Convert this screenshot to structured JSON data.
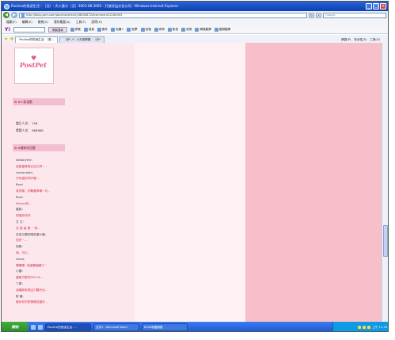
{
  "window": {
    "title": "Pauline的悦读生活 : 〔汉〕- 大人意义〔汉〕2003.08 2005 - 开放好出文化公司 - Windows Internet Explorer"
  },
  "address": {
    "url": "http://blog.yam.com/pauline/article/18630872#comment12164905",
    "search_placeholder": "Google"
  },
  "menu": [
    "檔案(F)",
    "編輯(E)",
    "檢視(V)",
    "我的最愛(A)",
    "工具(T)",
    "說明(H)"
  ],
  "yahoo_toolbar": {
    "logo": "Y!",
    "search_button": "網頁搜尋",
    "items": [
      "書籤",
      "首頁",
      "郵件",
      "知識+",
      "股票",
      "信箱",
      "奇摩",
      "影音",
      "相簿",
      "網頁翻譯",
      "闔閉翻譯"
    ]
  },
  "tabs": [
    {
      "label": "Pauline的悦读生活: 〔繁...",
      "active": true
    },
    {
      "label": "〔@*_*〕小天堂健康 - 〔@*",
      "active": false
    }
  ],
  "tab_tools": [
    "網頁(P)",
    "安全性(S)",
    "工具(O)"
  ],
  "blog": {
    "logo_text": "PostPet",
    "visits_header": "★人氣指數",
    "today_label": "當日人次：",
    "today_value": "158",
    "total_label": "累積人次：",
    "total_value": "888888",
    "comments_header": "★最新的回應",
    "comments": [
      {
        "who": "katablythe:",
        "msg": "這個還滿適合自己呀~..."
      },
      {
        "who": "rachanaldo:",
        "msg": "只有過的好好喔~..."
      },
      {
        "who": "Bowi",
        "msg": "真的喔，好難看捧場~可..."
      },
      {
        "who": "Bowi",
        "msg": "Winnie的..."
      },
      {
        "who": "雲姊：",
        "msg": "祝福你好好..."
      },
      {
        "who": "文 文：",
        "msg": "也 很 高 興 ~ 和..."
      },
      {
        "who": "名為沉潛的哺乳類小鹿：",
        "msg": "您好~..."
      },
      {
        "who": "劍魔：",
        "msg": "嗨，可以..."
      },
      {
        "who": "viana:",
        "msg": "喔喔喔~我還要繼續了~"
      },
      {
        "who": "小鑼：",
        "msg": "還蠻可愛的Winnie..."
      },
      {
        "who": "丫頭：",
        "msg": "這種原來是由力霸完全..."
      },
      {
        "who": "歐 晨：",
        "msg": "看到你的表情應該還在..."
      }
    ]
  },
  "taskbar": {
    "start": "開始",
    "tasks": [
      {
        "label": "Pauline的悦读生活 :...",
        "active": true
      },
      {
        "label": "文件1 - Microsoft Word",
        "active": false
      },
      {
        "label": "6000新聞摘要",
        "active": false
      }
    ],
    "clock": "上午 11:18"
  },
  "colors": {
    "left_column": "#fce8ec",
    "right_column": "#f6bfc9",
    "comment_text": "#d8304a",
    "header_bg": "#f2bfd0"
  }
}
